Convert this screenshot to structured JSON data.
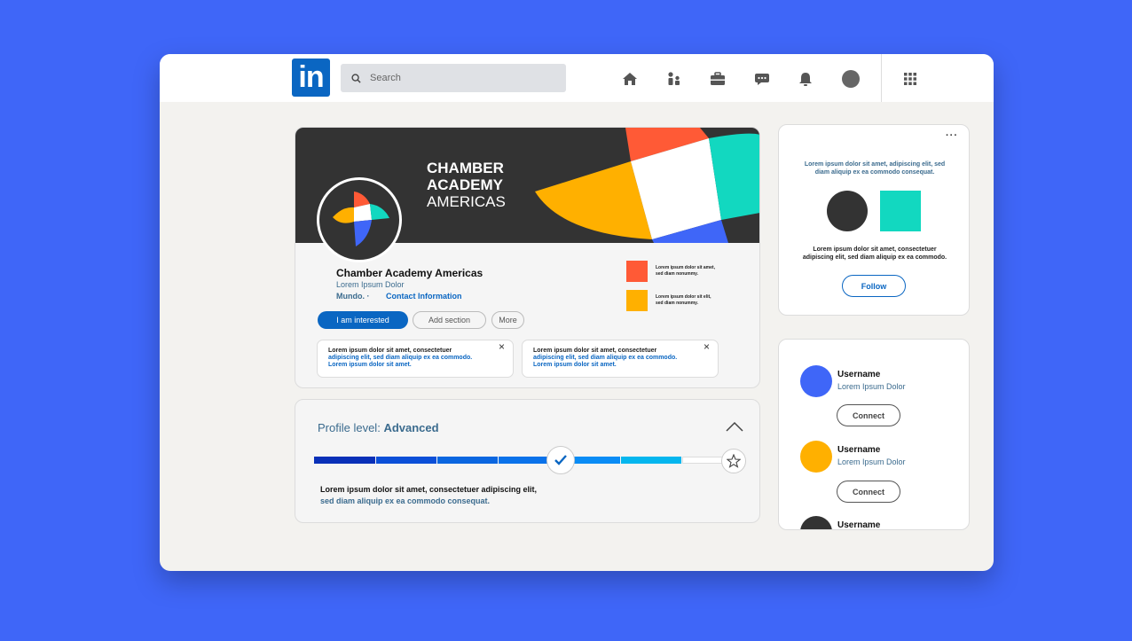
{
  "topbar": {
    "logo_text": "in",
    "search_placeholder": "Search"
  },
  "profile": {
    "banner_line1": "CHAMBER",
    "banner_line2": "ACADEMY",
    "banner_line3": "AMERICAS",
    "name": "Chamber Academy Americas",
    "headline": "Lorem Ipsum Dolor",
    "location": "Mundo. ·",
    "contact_link": "Contact Information",
    "interested_button": "I am interested",
    "add_section_button": "Add section",
    "more_button": "More",
    "highlights": [
      {
        "color": "#ff5a36",
        "line1": "Lorem ipsum dolor sit amet,",
        "line2": "sed diam nonummy."
      },
      {
        "color": "#ffb000",
        "line1": "Lorem ipsum dolor sit elit,",
        "line2": "sed diam nonummy."
      }
    ],
    "suggestions": [
      {
        "line1": "Lorem ipsum dolor sit amet, consectetuer",
        "line2": "adipiscing elit, sed diam aliquip ex ea commodo.",
        "link": "Lorem ipsum dolor sit amet.",
        "close": "×"
      },
      {
        "line1": "Lorem ipsum dolor sit amet, consectetuer",
        "line2": "adipiscing elit, sed diam aliquip ex ea commodo.",
        "link": "Lorem ipsum dolor sit amet.",
        "close": "×"
      }
    ]
  },
  "profile_level": {
    "label": "Profile level:",
    "level": "Advanced",
    "progress_fraction": 0.6,
    "desc_line1": "Lorem ipsum dolor sit amet, consectetuer adipiscing elit,",
    "desc_line2": "sed diam aliquip ex ea commodo consequat."
  },
  "ad_card": {
    "more_icon": "···",
    "top_text_line1": "Lorem ipsum dolor sit amet, adipiscing elit, sed",
    "top_text_line2": "diam aliquip ex ea commodo consequat.",
    "bottom_text_line1": "Lorem ipsum dolor sit amet, consectetuer",
    "bottom_text_line2": "adipiscing elit, sed diam aliquip ex ea commodo.",
    "follow_button": "Follow"
  },
  "people": [
    {
      "name": "Username",
      "subtitle": "Lorem Ipsum Dolor",
      "avatar_color": "#3f66f8",
      "connect": "Connect"
    },
    {
      "name": "Username",
      "subtitle": "Lorem Ipsum Dolor",
      "avatar_color": "#ffb000",
      "connect": "Connect"
    },
    {
      "name": "Username",
      "avatar_color": "#333333"
    }
  ]
}
